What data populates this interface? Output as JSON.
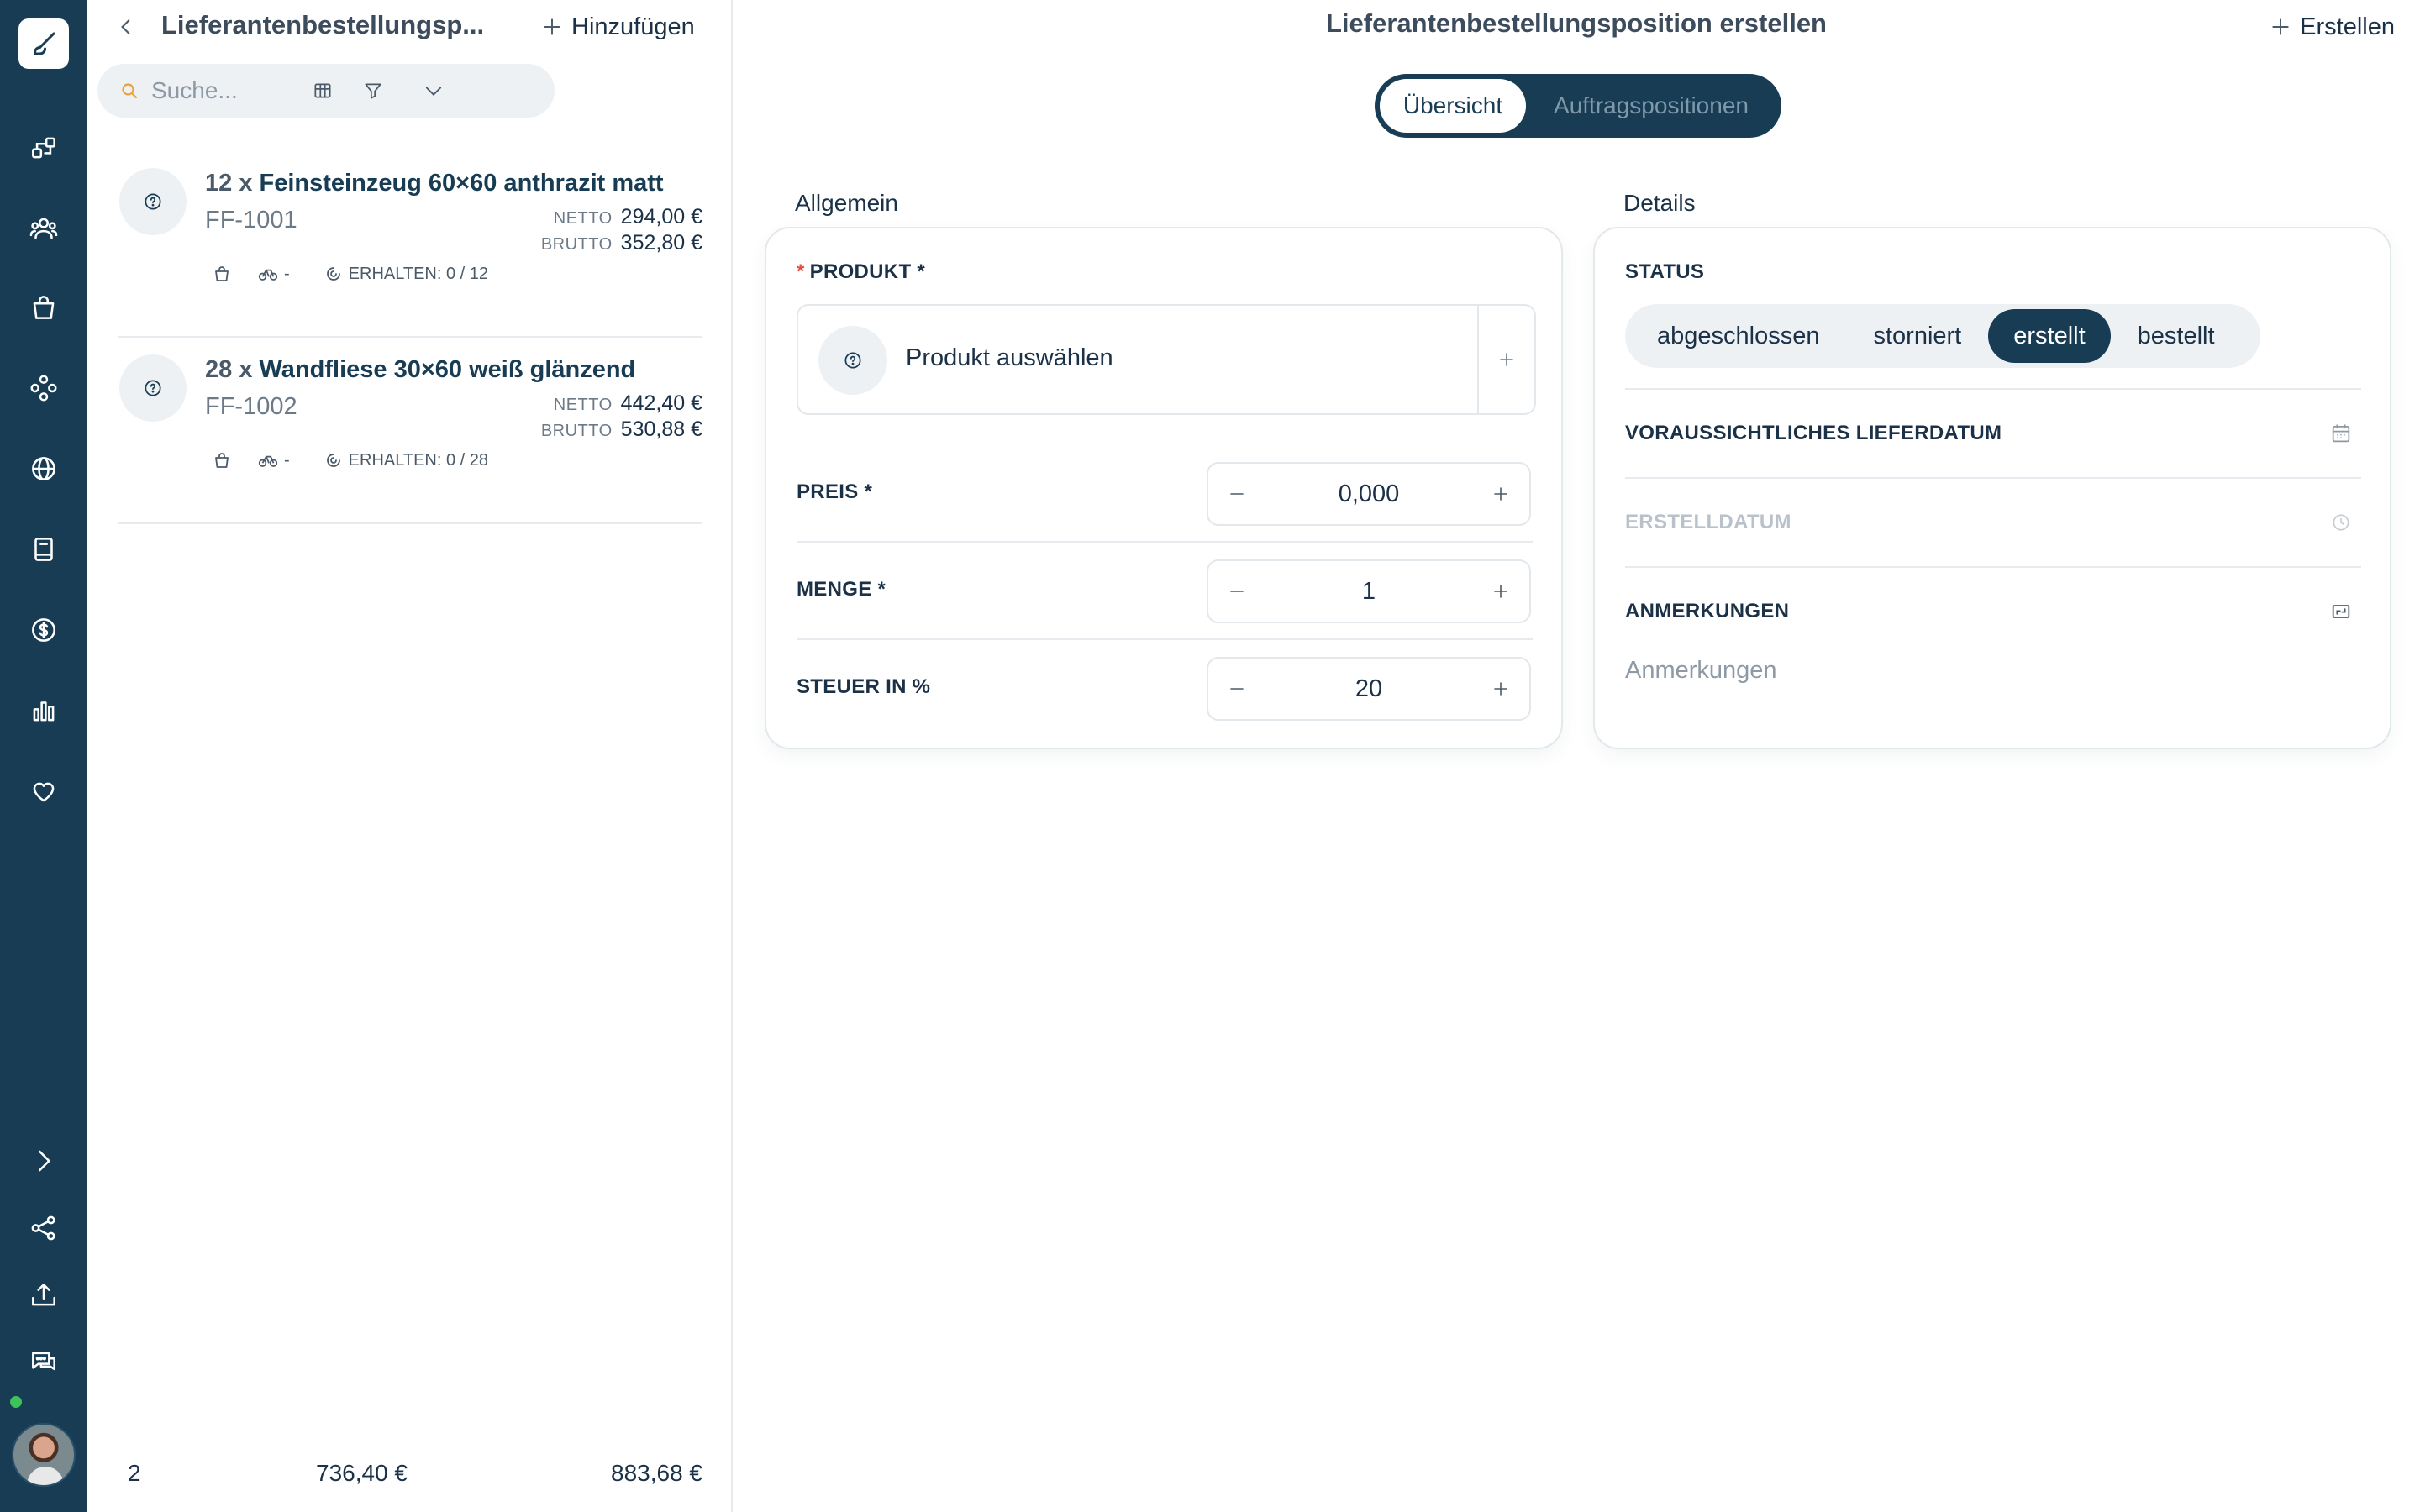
{
  "colors": {
    "rail": "#173c54",
    "accent": "#173c54",
    "border": "#e3e8ec",
    "required": "#e0523f",
    "online": "#3dc35a"
  },
  "list": {
    "title": "Lieferantenbestellungsp...",
    "add_label": "Hinzufügen",
    "search_placeholder": "Suche...",
    "items": [
      {
        "qty": "12 x",
        "name": "Feinsteinzeug 60×60 anthrazit matt",
        "sku": "FF-1001",
        "netto_label": "NETTO",
        "netto": "294,00 €",
        "brutto_label": "BRUTTO",
        "brutto": "352,80 €",
        "shipping": "-",
        "received": "ERHALTEN: 0 / 12"
      },
      {
        "qty": "28 x",
        "name": "Wandfliese 30×60 weiß glänzend",
        "sku": "FF-1002",
        "netto_label": "NETTO",
        "netto": "442,40 €",
        "brutto_label": "BRUTTO",
        "brutto": "530,88 €",
        "shipping": "-",
        "received": "ERHALTEN: 0 / 28"
      }
    ],
    "footer": {
      "count": "2",
      "netto_total": "736,40 €",
      "brutto_total": "883,68 €"
    }
  },
  "main": {
    "title": "Lieferantenbestellungsposition erstellen",
    "create_label": "Erstellen",
    "tabs": [
      {
        "label": "Übersicht"
      },
      {
        "label": "Auftragspositionen"
      }
    ],
    "general": {
      "section_title": "Allgemein",
      "product_label": "PRODUKT *",
      "product_placeholder": "Produkt auswählen",
      "price_label": "PREIS *",
      "price_value": "0,000",
      "quantity_label": "MENGE *",
      "quantity_value": "1",
      "tax_label": "STEUER IN %",
      "tax_value": "20"
    },
    "details": {
      "section_title": "Details",
      "status_label": "STATUS",
      "status_options": [
        "abgeschlossen",
        "storniert",
        "erstellt",
        "bestellt"
      ],
      "status_selected": "erstellt",
      "delivery_date_label": "VORAUSSICHTLICHES LIEFERDATUM",
      "created_date_label": "ERSTELLDATUM",
      "notes_label": "ANMERKUNGEN",
      "notes_placeholder": "Anmerkungen"
    }
  }
}
